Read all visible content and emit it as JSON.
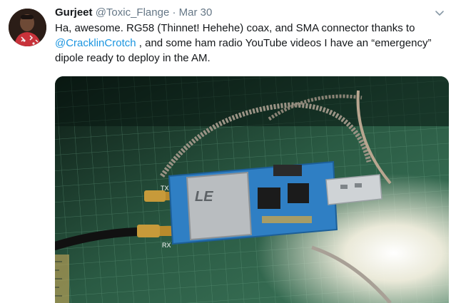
{
  "tweet": {
    "display_name": "Gurjeet",
    "handle": "@Toxic_Flange",
    "separator": "·",
    "date": "Mar 30",
    "text_part1": "Ha, awesome. RG58 (Thinnet! Hehehe) coax, and SMA connector thanks to ",
    "mention": "@CracklinCrotch",
    "text_part2": " , and some ham radio YouTube videos I have an “emergency” dipole ready to deploy in the AM.",
    "board_labels": {
      "tx": "TX",
      "rx": "RX"
    }
  },
  "icons": {
    "caret": "chevron-down-icon"
  }
}
